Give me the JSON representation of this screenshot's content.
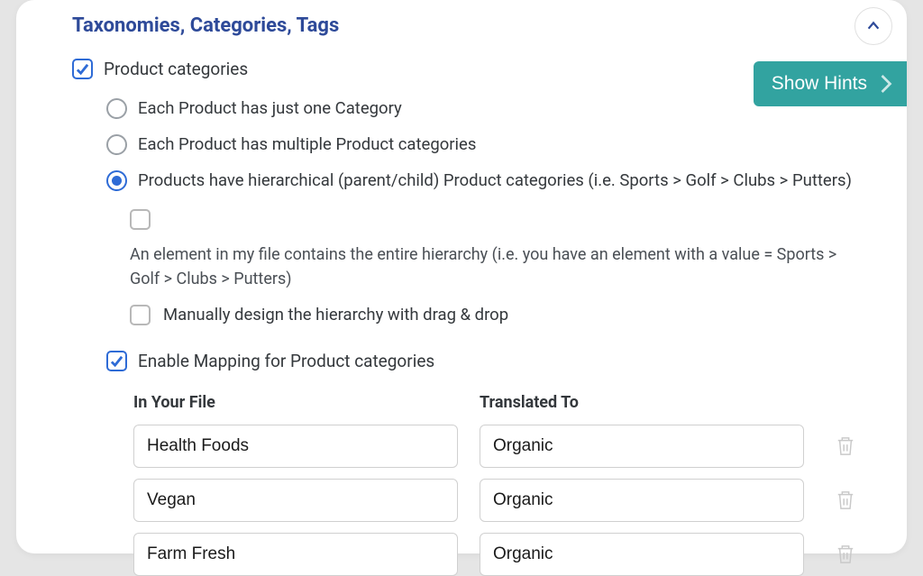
{
  "section": {
    "title": "Taxonomies, Categories, Tags"
  },
  "hints_button": "Show Hints",
  "product_categories": {
    "label": "Product categories",
    "checked": true
  },
  "radios": {
    "r1": "Each Product has just one Category",
    "r2": "Each Product has multiple Product categories",
    "r3": "Products have hierarchical (parent/child) Product categories (i.e. Sports > Golf > Clubs > Putters)"
  },
  "hierarchy": {
    "element_desc": "An element in my file contains the entire hierarchy (i.e. you have an element with a value = Sports > Golf > Clubs > Putters)",
    "manual_label": "Manually design the hierarchy with drag & drop"
  },
  "enable_mapping": {
    "label": "Enable Mapping for Product categories",
    "checked": true
  },
  "mapping": {
    "header_source": "In Your File",
    "header_target": "Translated To",
    "rows": [
      {
        "source": "Health Foods",
        "target": "Organic"
      },
      {
        "source": "Vegan",
        "target": "Organic"
      },
      {
        "source": "Farm Fresh",
        "target": "Organic"
      }
    ]
  }
}
